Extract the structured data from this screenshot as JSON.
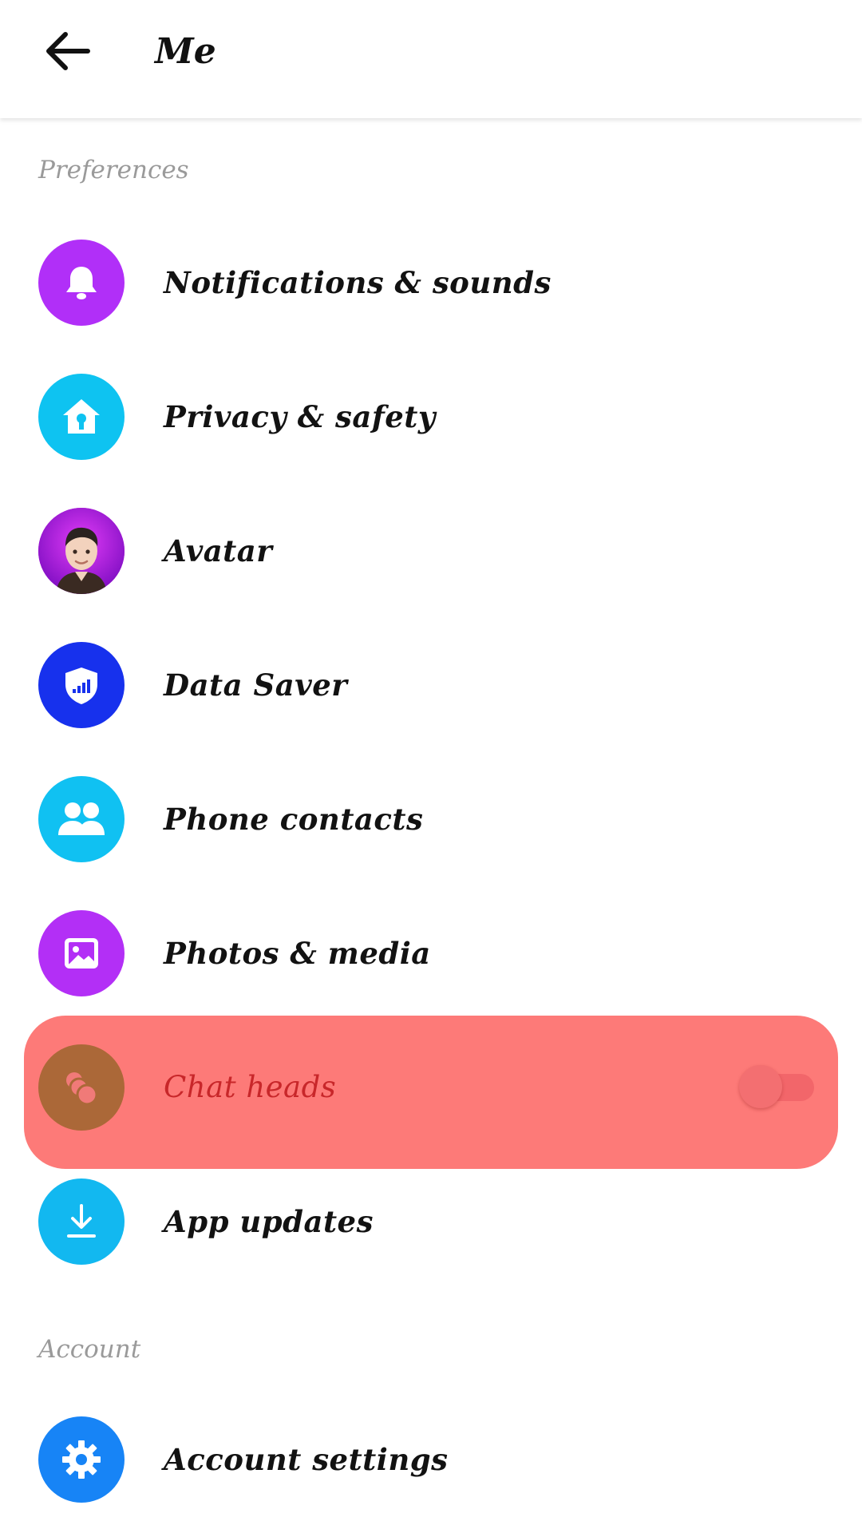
{
  "header": {
    "title": "Me",
    "back_icon": "arrow-left-icon"
  },
  "sections": {
    "preferences": "Preferences",
    "account": "Account"
  },
  "items": [
    {
      "label": "Notifications & sounds",
      "icon": "bell-icon",
      "color": "#b12ff8"
    },
    {
      "label": "Privacy & safety",
      "icon": "home-lock-icon",
      "color": "#0ec3f1"
    },
    {
      "label": "Avatar",
      "icon": "avatar-icon",
      "color": "#c513e6"
    },
    {
      "label": "Data Saver",
      "icon": "shield-signal-icon",
      "color": "#1731ed"
    },
    {
      "label": "Phone contacts",
      "icon": "people-icon",
      "color": "#10c1f2"
    },
    {
      "label": "Photos & media",
      "icon": "image-icon",
      "color": "#b32ff6"
    },
    {
      "label": "Chat heads",
      "icon": "chat-heads-icon",
      "color": "#ab6838",
      "toggle": "off"
    },
    {
      "label": "App updates",
      "icon": "download-icon",
      "color": "#12b8f0"
    },
    {
      "label": "Account settings",
      "icon": "gear-icon",
      "color": "#1784f6"
    }
  ],
  "colors": {
    "highlight": "#fd7a78",
    "highlight_text": "#c8272a",
    "section_label": "#9a9a9a"
  }
}
